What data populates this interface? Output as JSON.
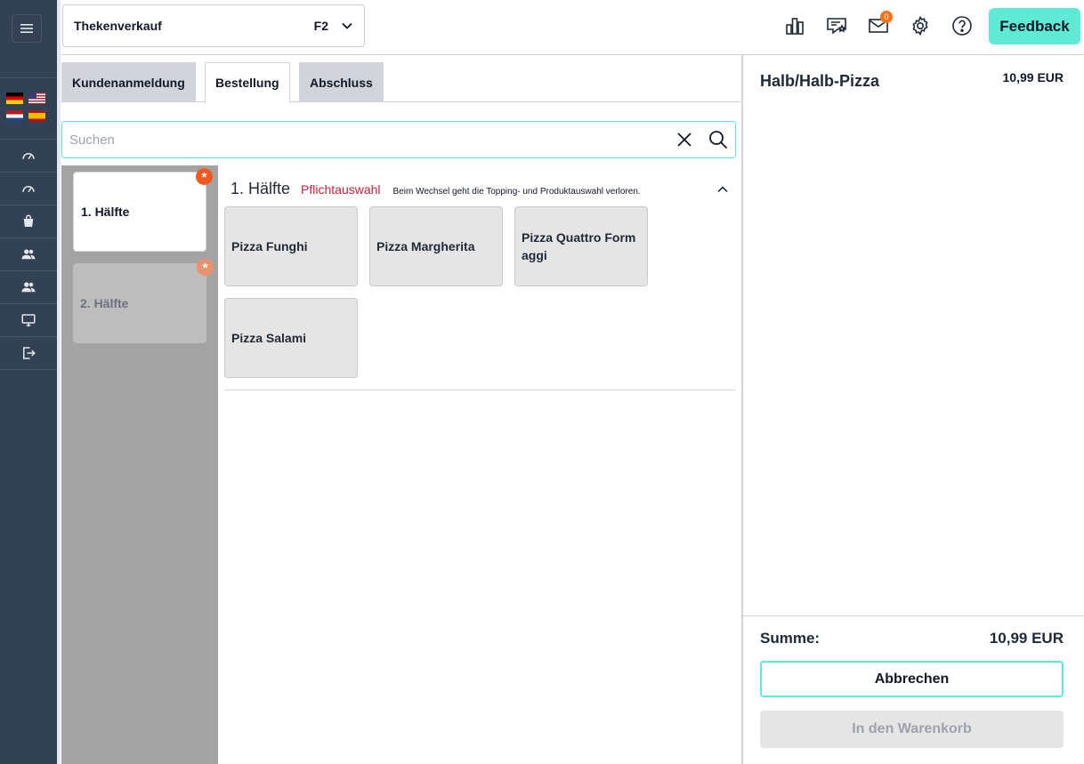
{
  "header": {
    "mode_select": {
      "label": "Thekenverkauf",
      "hotkey": "F2"
    },
    "mail_badge": "0",
    "feedback_label": "Feedback"
  },
  "tabs": [
    {
      "label": "Kundenanmeldung",
      "active": false
    },
    {
      "label": "Bestellung",
      "active": true
    },
    {
      "label": "Abschluss",
      "active": false
    }
  ],
  "search": {
    "placeholder": "Suchen",
    "value": ""
  },
  "halves": [
    {
      "label": "1. Hälfte",
      "selected": true,
      "required_mark": "*"
    },
    {
      "label": "2. Hälfte",
      "selected": false,
      "required_mark": "*"
    }
  ],
  "group": {
    "title": "1. Hälfte",
    "required_label": "Pflichtauswahl",
    "hint": "Beim Wechsel geht die Topping- und Produktauswahl verloren."
  },
  "products": [
    {
      "name": "Pizza Funghi"
    },
    {
      "name": "Pizza Margherita"
    },
    {
      "name": "Pizza Quattro Form aggi"
    },
    {
      "name": "Pizza Salami"
    }
  ],
  "cart": {
    "item_title": "Halb/Halb-Pizza",
    "item_price": "10,99 EUR",
    "sum_label": "Summe:",
    "sum_value": "10,99 EUR",
    "cancel_label": "Abbrechen",
    "add_to_cart_label": "In den Warenkorb"
  },
  "colors": {
    "accent": "#5eead4",
    "rail": "#334155",
    "required": "#c81e3a",
    "badge": "#f97316"
  }
}
